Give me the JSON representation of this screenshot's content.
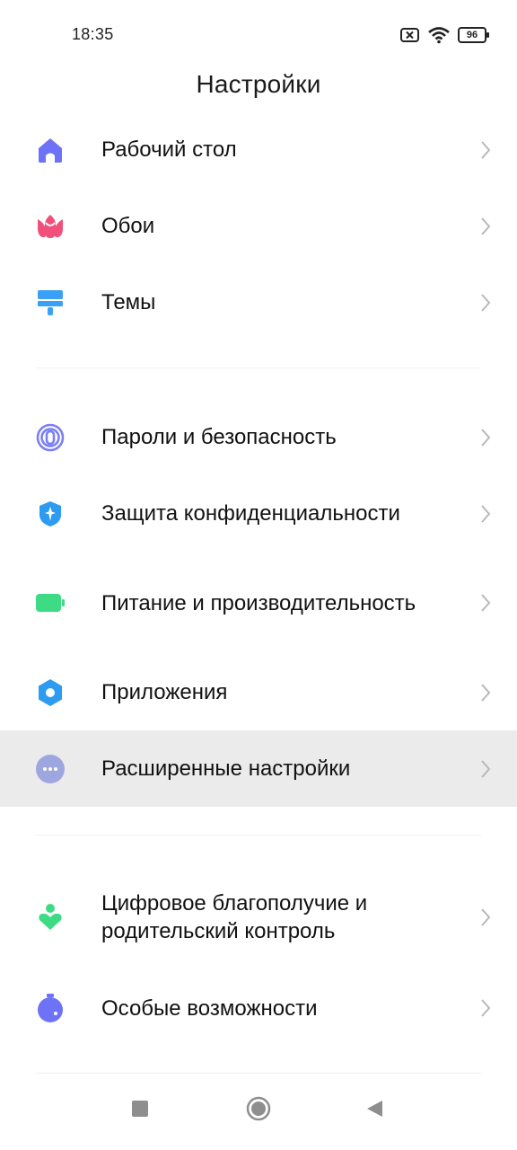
{
  "status_bar": {
    "time": "18:35",
    "battery_level": "96",
    "icons": [
      "sim-x-icon",
      "wifi-icon",
      "battery-icon"
    ]
  },
  "header": {
    "title": "Настройки"
  },
  "groups": [
    {
      "items": [
        {
          "label": "Рабочий стол",
          "icon": "home-icon",
          "color": "#6d72f6"
        },
        {
          "label": "Обои",
          "icon": "tulip-icon",
          "color": "#f0507a"
        },
        {
          "label": "Темы",
          "icon": "paint-roller-icon",
          "color": "#3aa0f5"
        }
      ]
    },
    {
      "items": [
        {
          "label": "Пароли и безопасность",
          "icon": "fingerprint-icon",
          "color": "#7b7ff5"
        },
        {
          "label": "Защита конфиденциальности",
          "icon": "privacy-shield-icon",
          "color": "#2d9bf0"
        },
        {
          "label": "Питание и производительность",
          "icon": "battery-green-icon",
          "color": "#3ddc84"
        },
        {
          "label": "Приложения",
          "icon": "gear-icon",
          "color": "#2d9bf0"
        },
        {
          "label": "Расширенные настройки",
          "icon": "more-dots-icon",
          "color": "#9ea6e0",
          "highlighted": true
        }
      ]
    },
    {
      "items": [
        {
          "label": "Цифровое благополучие и родительский контроль",
          "icon": "wellbeing-icon",
          "color": "#3ddc84"
        },
        {
          "label": "Особые возможности",
          "icon": "accessibility-timer-icon",
          "color": "#6d72f6"
        }
      ]
    }
  ],
  "nav_bar": {
    "buttons": [
      "recents-square-icon",
      "home-circle-icon",
      "back-triangle-icon"
    ]
  }
}
